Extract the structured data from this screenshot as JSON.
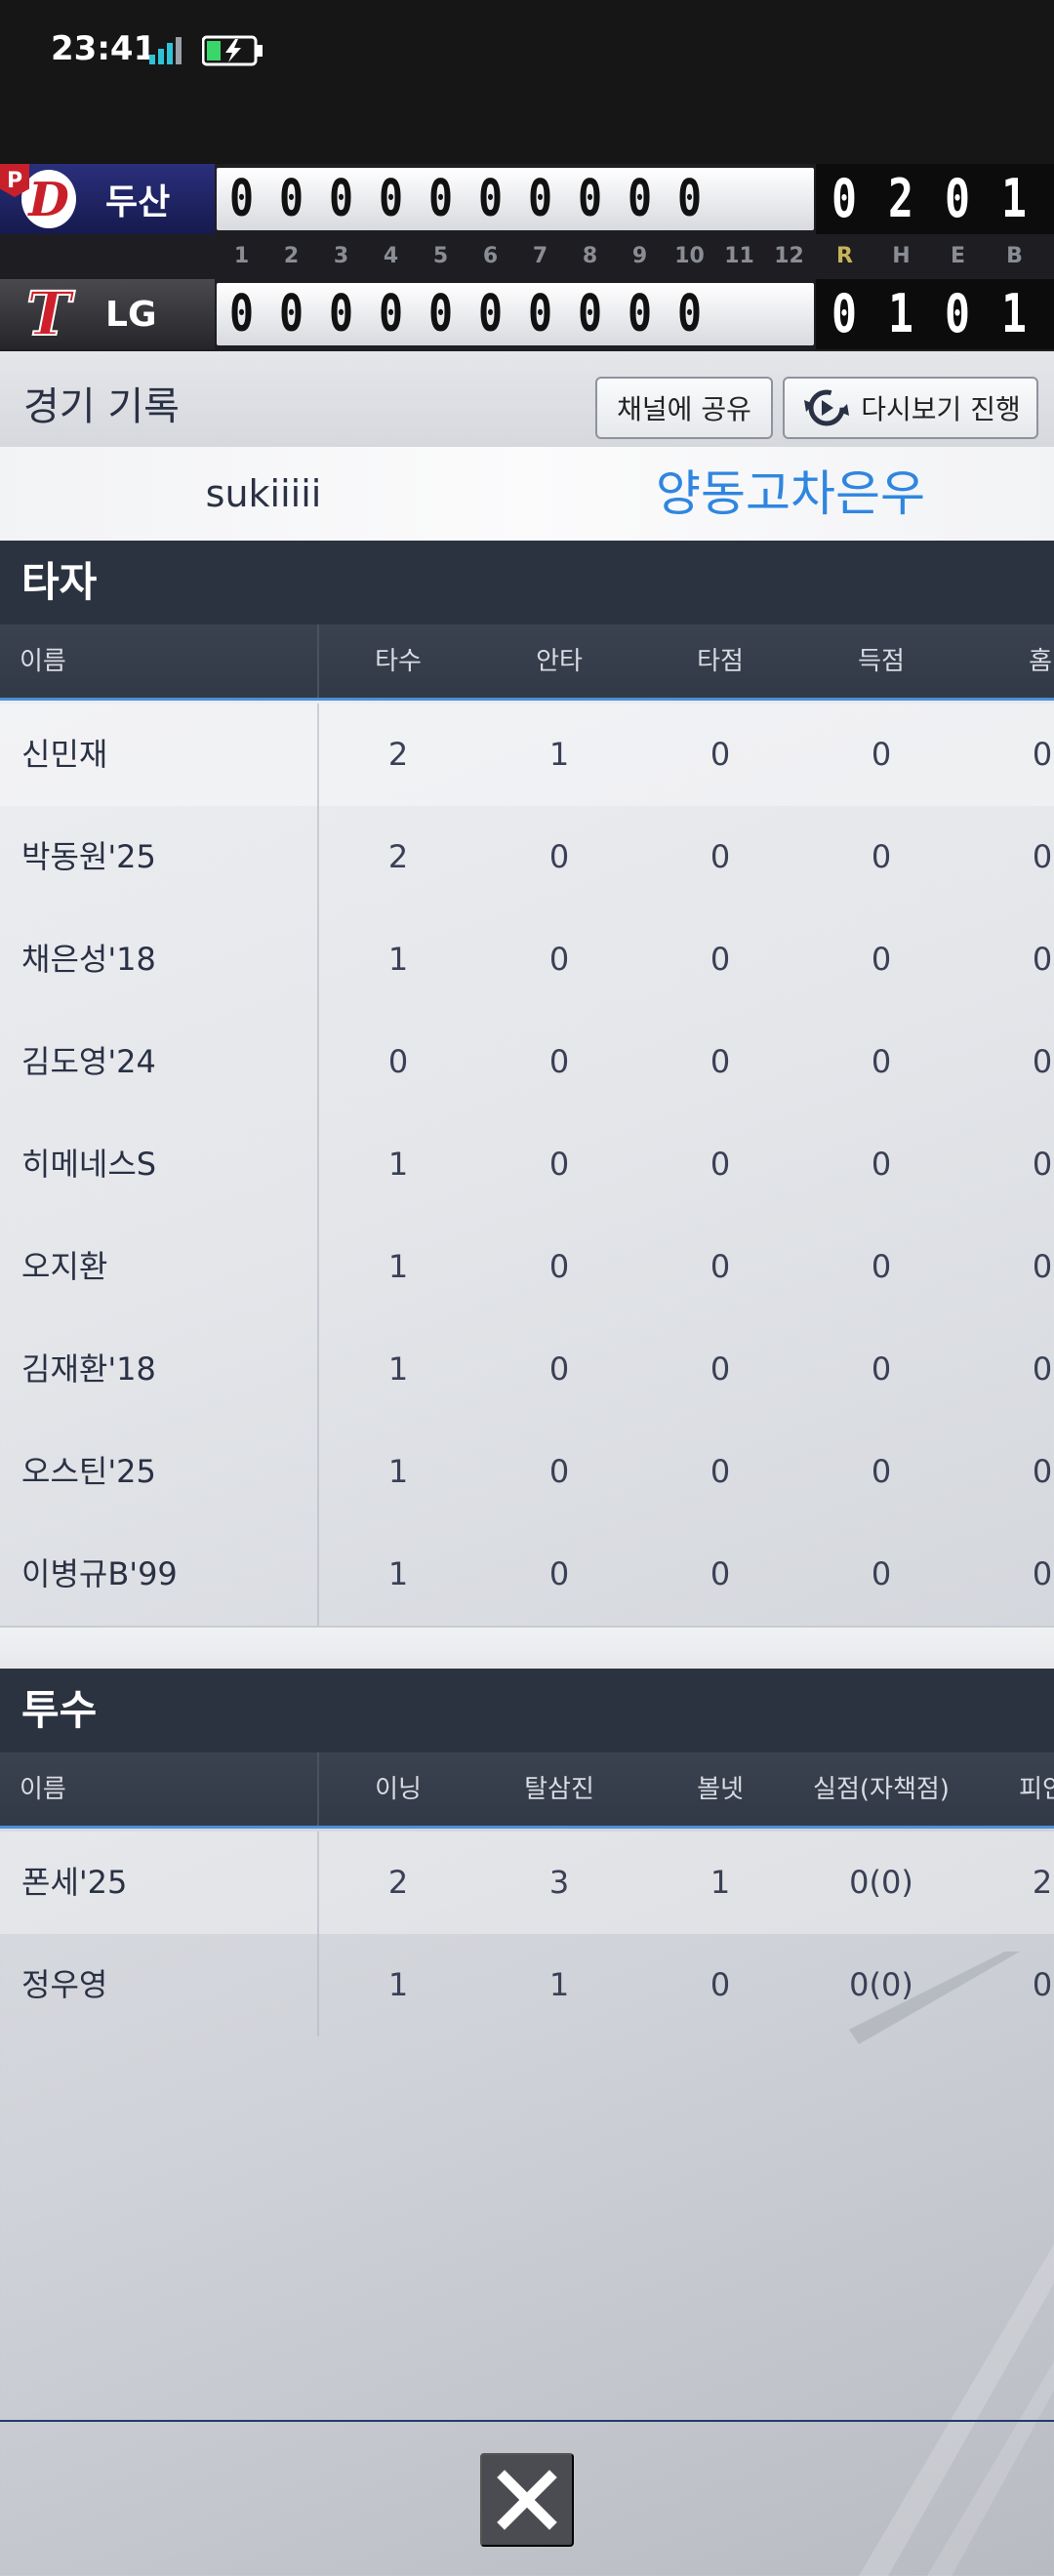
{
  "status": {
    "time": "23:41"
  },
  "scoreboard": {
    "away": {
      "name": "두산",
      "badge": "P",
      "logo_letter": "D",
      "innings": [
        "0",
        "0",
        "0",
        "0",
        "0",
        "0",
        "0",
        "0",
        "0",
        "0"
      ],
      "rheb": [
        "0",
        "2",
        "0",
        "1"
      ]
    },
    "home": {
      "name": "LG",
      "logo_letter": "T",
      "innings": [
        "0",
        "0",
        "0",
        "0",
        "0",
        "0",
        "0",
        "0",
        "0",
        "0"
      ],
      "rheb": [
        "0",
        "1",
        "0",
        "1"
      ]
    },
    "inning_labels": [
      "1",
      "2",
      "3",
      "4",
      "5",
      "6",
      "7",
      "8",
      "9",
      "10",
      "11",
      "12"
    ],
    "rheb_labels": [
      "R",
      "H",
      "E",
      "B"
    ],
    "colors": {
      "away_bg": "#1f2466",
      "rheb_label_r": "#c9b35a"
    }
  },
  "record": {
    "title": "경기 기록",
    "share_label": "채널에 공유",
    "replay_label": "다시보기 진행"
  },
  "players": {
    "left": "sukiiiii",
    "right": "양동고차은우"
  },
  "batters": {
    "title": "타자",
    "columns": [
      "이름",
      "타수",
      "안타",
      "타점",
      "득점",
      "홈런"
    ],
    "rows": [
      {
        "name": "신민재",
        "ab": "2",
        "h": "1",
        "rbi": "0",
        "r": "0",
        "hr": "0"
      },
      {
        "name": "박동원'25",
        "ab": "2",
        "h": "0",
        "rbi": "0",
        "r": "0",
        "hr": "0"
      },
      {
        "name": "채은성'18",
        "ab": "1",
        "h": "0",
        "rbi": "0",
        "r": "0",
        "hr": "0"
      },
      {
        "name": "김도영'24",
        "ab": "0",
        "h": "0",
        "rbi": "0",
        "r": "0",
        "hr": "0"
      },
      {
        "name": "히메네스S",
        "ab": "1",
        "h": "0",
        "rbi": "0",
        "r": "0",
        "hr": "0"
      },
      {
        "name": "오지환",
        "ab": "1",
        "h": "0",
        "rbi": "0",
        "r": "0",
        "hr": "0"
      },
      {
        "name": "김재환'18",
        "ab": "1",
        "h": "0",
        "rbi": "0",
        "r": "0",
        "hr": "0"
      },
      {
        "name": "오스틴'25",
        "ab": "1",
        "h": "0",
        "rbi": "0",
        "r": "0",
        "hr": "0"
      },
      {
        "name": "이병규B'99",
        "ab": "1",
        "h": "0",
        "rbi": "0",
        "r": "0",
        "hr": "0"
      }
    ]
  },
  "pitchers": {
    "title": "투수",
    "columns": [
      "이름",
      "이닝",
      "탈삼진",
      "볼넷",
      "실점(자책점)",
      "피안타"
    ],
    "rows": [
      {
        "name": "폰세'25",
        "ip": "2",
        "so": "3",
        "bb": "1",
        "er": "0(0)",
        "ha": "2"
      },
      {
        "name": "정우영",
        "ip": "1",
        "so": "1",
        "bb": "0",
        "er": "0(0)",
        "ha": "0"
      }
    ]
  }
}
